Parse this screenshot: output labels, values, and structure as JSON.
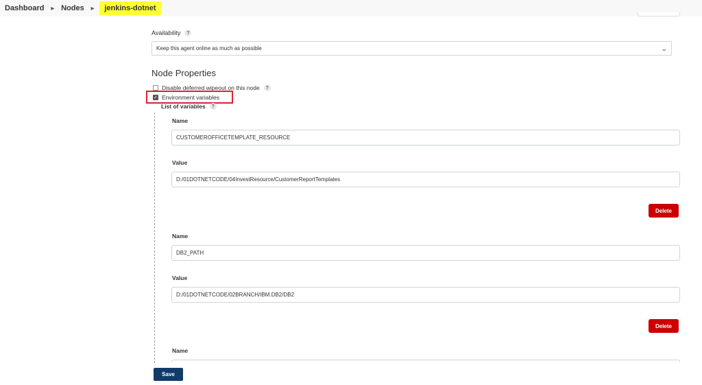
{
  "breadcrumb": {
    "items": [
      "Dashboard",
      "Nodes"
    ],
    "current": "jenkins-dotnet"
  },
  "availability": {
    "label": "Availability",
    "help": "?",
    "selected": "Keep this agent online as much as possible"
  },
  "node_properties": {
    "title": "Node Properties",
    "disable_deferred_wipeout": {
      "label": "Disable deferred wipeout on this node",
      "checked": false,
      "help": "?"
    },
    "environment_variables": {
      "label": "Environment variables",
      "checked": true
    },
    "list_of_variables": {
      "label": "List of variables",
      "help": "?"
    },
    "variables": [
      {
        "name_label": "Name",
        "name": "CUSTOMEROFFICETEMPLATE_RESOURCE",
        "value_label": "Value",
        "value": "D:/01DOTNETCODE/04InvestResource/CustomerReportTemplates",
        "delete_label": "Delete"
      },
      {
        "name_label": "Name",
        "name": "DB2_PATH",
        "value_label": "Value",
        "value": "D:/01DOTNETCODE/02BRANCH/IBM.DB2/DB2",
        "delete_label": "Delete"
      },
      {
        "name_label": "Name"
      }
    ]
  },
  "save_label": "Save",
  "colors": {
    "highlight": "#ffff33",
    "annotation_box": "#d9232d",
    "delete_button": "#cc0003",
    "save_button": "#123b6a"
  }
}
